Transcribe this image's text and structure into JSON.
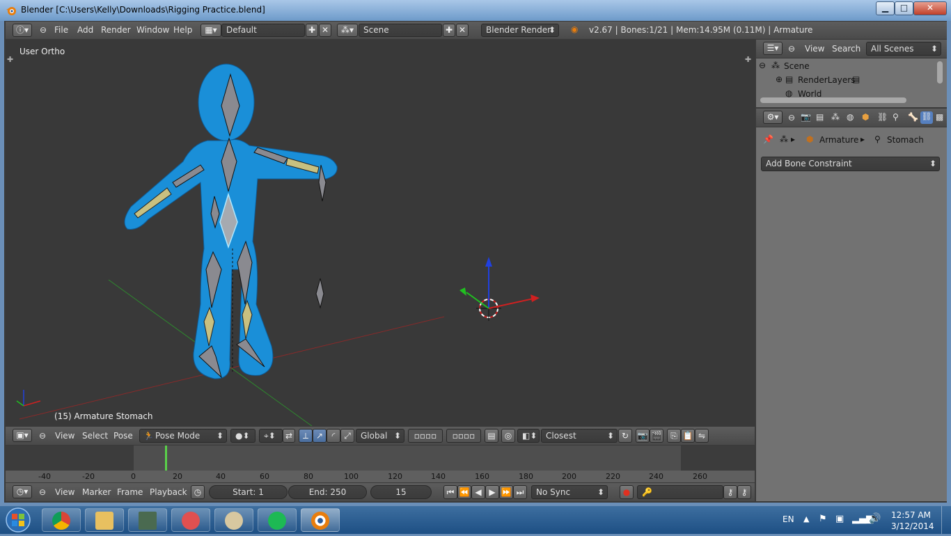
{
  "window": {
    "title": "Blender [C:\\Users\\Kelly\\Downloads\\Rigging Practice.blend]",
    "minimize": "▁",
    "maximize": "□",
    "close": "✕"
  },
  "info_header": {
    "menus": [
      "File",
      "Add",
      "Render",
      "Window",
      "Help"
    ],
    "screen_layout": "Default",
    "scene": "Scene",
    "render_engine": "Blender Render",
    "stats": "v2.67 | Bones:1/21 | Mem:14.95M (0.11M) | Armature"
  },
  "viewport": {
    "view_name": "User Ortho",
    "active_info": "(15) Armature Stomach"
  },
  "view3d_header": {
    "menus": [
      "View",
      "Select",
      "Pose"
    ],
    "mode": "Pose Mode",
    "orientation": "Global",
    "snap_target": "Closest"
  },
  "timeline": {
    "ticks": [
      "-40",
      "-20",
      "0",
      "20",
      "40",
      "60",
      "80",
      "100",
      "120",
      "140",
      "160",
      "180",
      "200",
      "220",
      "240",
      "260"
    ],
    "current_frame_marker": 15
  },
  "timeline_header": {
    "menus": [
      "View",
      "Marker",
      "Frame",
      "Playback"
    ],
    "start": "Start: 1",
    "end": "End: 250",
    "current_frame": "15",
    "sync": "No Sync"
  },
  "outliner": {
    "menus": [
      "View",
      "Search"
    ],
    "filter": "All Scenes",
    "tree": [
      "Scene",
      "RenderLayers",
      "World"
    ]
  },
  "properties": {
    "breadcrumb_object": "Armature",
    "breadcrumb_bone": "Stomach",
    "add_constraint": "Add Bone Constraint"
  },
  "tray": {
    "language": "EN",
    "time": "12:57 AM",
    "date": "3/12/2014"
  },
  "colors": {
    "mesh_blue": "#1a8fd8",
    "bone_gray": "#8a8a90",
    "bone_selected": "#b0e8ff",
    "ik_yellow": "#c8c080",
    "axis_x": "#d02020",
    "axis_y": "#20c020",
    "axis_z": "#2040e0"
  }
}
